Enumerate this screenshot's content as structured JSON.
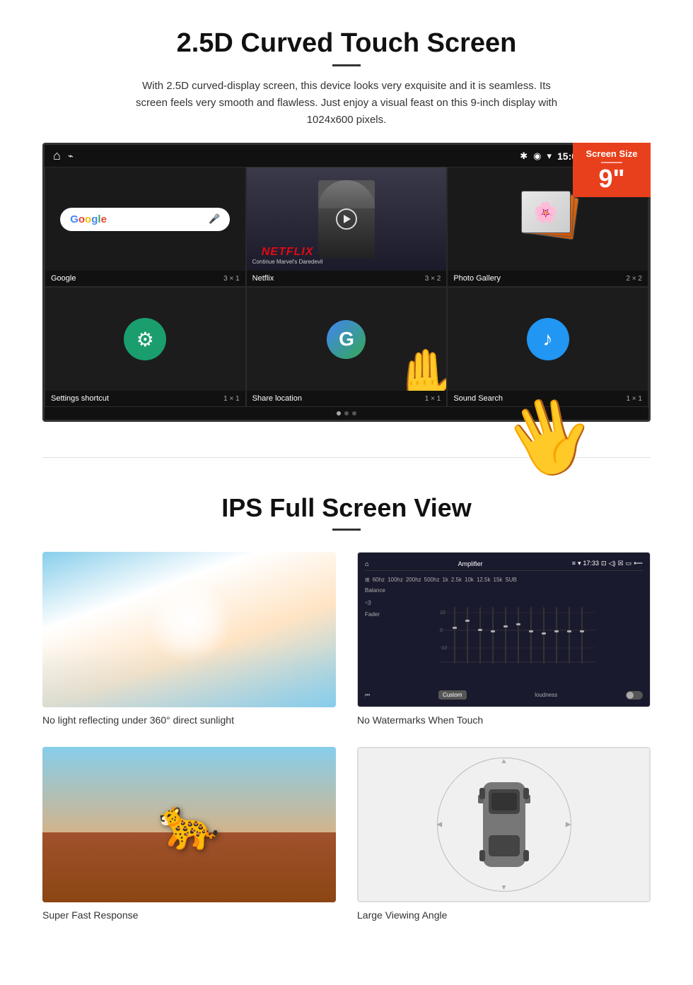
{
  "section1": {
    "title": "2.5D Curved Touch Screen",
    "description": "With 2.5D curved-display screen, this device looks very exquisite and it is seamless. Its screen feels very smooth and flawless. Just enjoy a visual feast on this 9-inch display with 1024x600 pixels.",
    "badge": {
      "label": "Screen Size",
      "size": "9\""
    },
    "statusBar": {
      "time": "15:06"
    },
    "apps": [
      {
        "name": "Google",
        "size": "3 × 1"
      },
      {
        "name": "Netflix",
        "size": "3 × 2"
      },
      {
        "name": "Photo Gallery",
        "size": "2 × 2"
      },
      {
        "name": "Settings shortcut",
        "size": "1 × 1"
      },
      {
        "name": "Share location",
        "size": "1 × 1"
      },
      {
        "name": "Sound Search",
        "size": "1 × 1"
      }
    ],
    "netflix": {
      "logo": "NETFLIX",
      "subtitle": "Continue Marvel's Daredevil"
    }
  },
  "section2": {
    "title": "IPS Full Screen View",
    "features": [
      {
        "id": "sunlight",
        "caption": "No light reflecting under 360° direct sunlight"
      },
      {
        "id": "watermark",
        "caption": "No Watermarks When Touch"
      },
      {
        "id": "cheetah",
        "caption": "Super Fast Response"
      },
      {
        "id": "car",
        "caption": "Large Viewing Angle"
      }
    ]
  }
}
